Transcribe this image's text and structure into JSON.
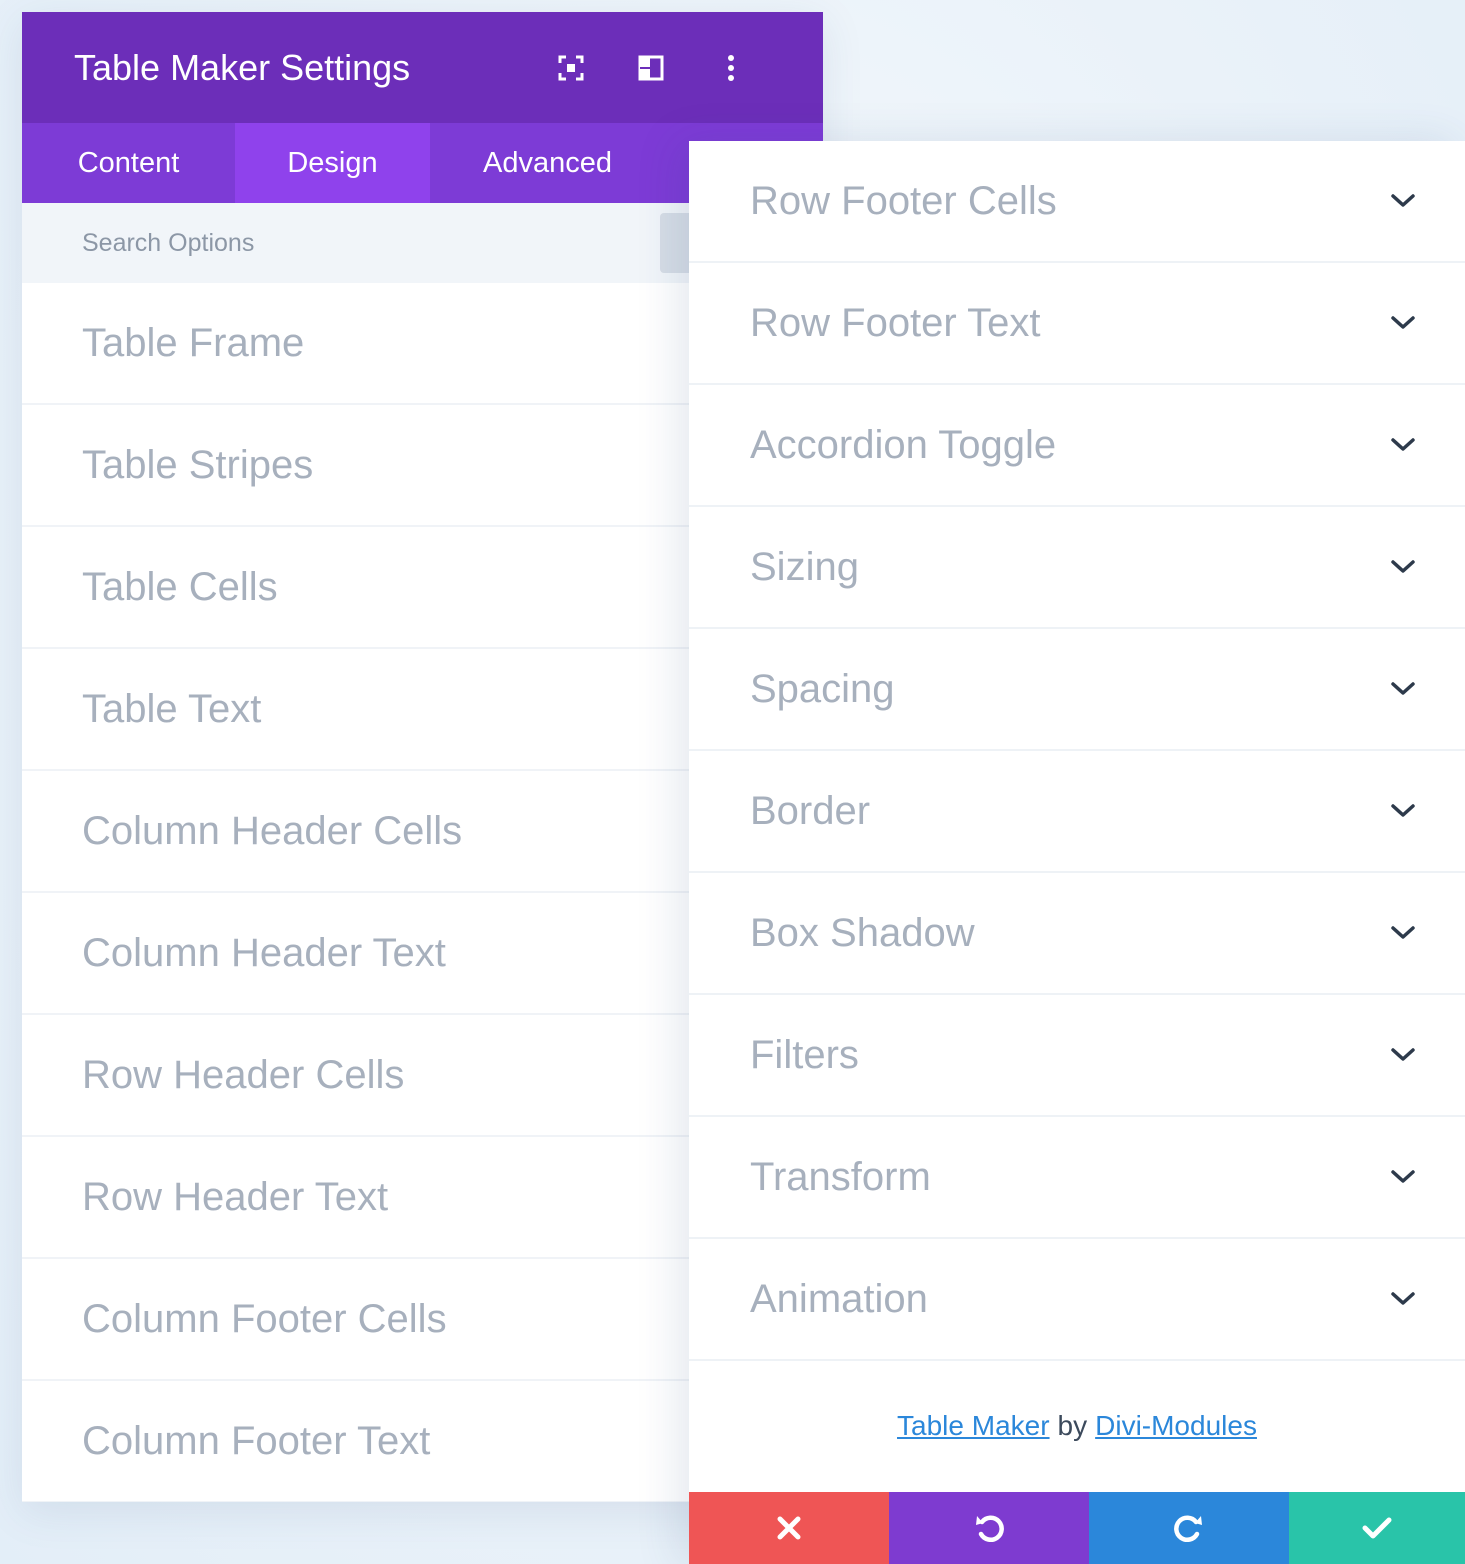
{
  "header": {
    "title": "Table Maker Settings",
    "icons": [
      "focus-icon",
      "split-view-icon",
      "more-options-icon"
    ]
  },
  "tabs": [
    {
      "label": "Content"
    },
    {
      "label": "Design",
      "active": true
    },
    {
      "label": "Advanced"
    }
  ],
  "search": {
    "placeholder": "Search Options"
  },
  "left_groups": [
    "Table Frame",
    "Table Stripes",
    "Table Cells",
    "Table Text",
    "Column Header Cells",
    "Column Header Text",
    "Row Header Cells",
    "Row Header Text",
    "Column Footer Cells",
    "Column Footer Text"
  ],
  "right_groups": [
    "Row Footer Cells",
    "Row Footer Text",
    "Accordion Toggle",
    "Sizing",
    "Spacing",
    "Border",
    "Box Shadow",
    "Filters",
    "Transform",
    "Animation"
  ],
  "credit": {
    "product": "Table Maker",
    "by": "by",
    "author": "Divi-Modules"
  },
  "actions": [
    "close-icon",
    "undo-icon",
    "redo-icon",
    "check-icon"
  ],
  "colors": {
    "header": "#6c2eb9",
    "tabs": "#7d3bd6",
    "tab_active": "#8f42ec",
    "cancel": "#ef5555",
    "undo": "#7e3bd0",
    "redo": "#2b87da",
    "save": "#29c4a9"
  }
}
